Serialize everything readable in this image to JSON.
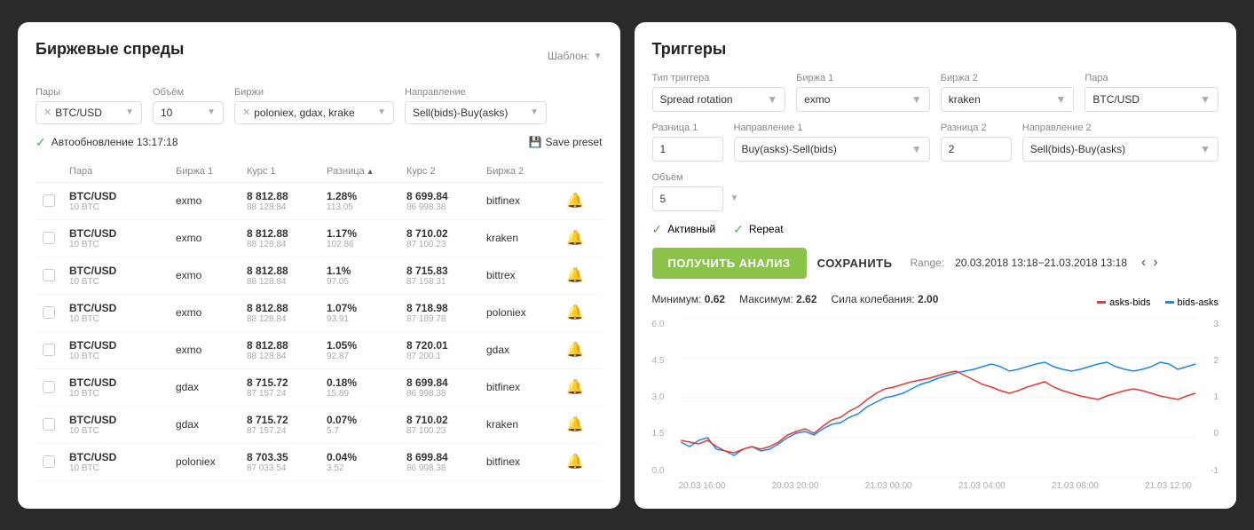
{
  "left_panel": {
    "title": "Биржевые спреды",
    "template_label": "Шаблон:",
    "filters": {
      "pairs_label": "Пары",
      "pairs_value": "BTC/USD",
      "volume_label": "Объём",
      "volume_value": "10",
      "exchanges_label": "Биржи",
      "exchanges_value": "poloniex, gdax, krake",
      "direction_label": "Направление",
      "direction_value": "Sell(bids)-Buy(asks)"
    },
    "autoupdate": "Автообновление 13:17:18",
    "save_preset": "Save preset",
    "table": {
      "columns": [
        "",
        "Пара",
        "Биржа 1",
        "Курс 1",
        "Разница",
        "Курс 2",
        "Биржа 2",
        ""
      ],
      "rows": [
        {
          "pair": "BTC/USD",
          "volume": "10 BTC",
          "exchange1": "exmo",
          "price1": "8 812.88",
          "price1_sub": "88 128.84",
          "diff_pct": "1.28%",
          "diff_abs": "113.05",
          "price2": "8 699.84",
          "price2_sub": "86 998.38",
          "exchange2": "bitfinex"
        },
        {
          "pair": "BTC/USD",
          "volume": "10 BTC",
          "exchange1": "exmo",
          "price1": "8 812.88",
          "price1_sub": "88 128.84",
          "diff_pct": "1.17%",
          "diff_abs": "102.86",
          "price2": "8 710.02",
          "price2_sub": "87 100.23",
          "exchange2": "kraken"
        },
        {
          "pair": "BTC/USD",
          "volume": "10 BTC",
          "exchange1": "exmo",
          "price1": "8 812.88",
          "price1_sub": "88 128.84",
          "diff_pct": "1.1%",
          "diff_abs": "97.05",
          "price2": "8 715.83",
          "price2_sub": "87 158.31",
          "exchange2": "bittrex"
        },
        {
          "pair": "BTC/USD",
          "volume": "10 BTC",
          "exchange1": "exmo",
          "price1": "8 812.88",
          "price1_sub": "88 128.84",
          "diff_pct": "1.07%",
          "diff_abs": "93.91",
          "price2": "8 718.98",
          "price2_sub": "87 189.78",
          "exchange2": "poloniex"
        },
        {
          "pair": "BTC/USD",
          "volume": "10 BTC",
          "exchange1": "exmo",
          "price1": "8 812.88",
          "price1_sub": "88 128.84",
          "diff_pct": "1.05%",
          "diff_abs": "92.87",
          "price2": "8 720.01",
          "price2_sub": "87 200.1",
          "exchange2": "gdax"
        },
        {
          "pair": "BTC/USD",
          "volume": "10 BTC",
          "exchange1": "gdax",
          "price1": "8 715.72",
          "price1_sub": "87 157.24",
          "diff_pct": "0.18%",
          "diff_abs": "15.89",
          "price2": "8 699.84",
          "price2_sub": "86 998.38",
          "exchange2": "bitfinex"
        },
        {
          "pair": "BTC/USD",
          "volume": "10 BTC",
          "exchange1": "gdax",
          "price1": "8 715.72",
          "price1_sub": "87 157.24",
          "diff_pct": "0.07%",
          "diff_abs": "5.7",
          "price2": "8 710.02",
          "price2_sub": "87 100.23",
          "exchange2": "kraken"
        },
        {
          "pair": "BTC/USD",
          "volume": "10 BTC",
          "exchange1": "poloniex",
          "price1": "8 703.35",
          "price1_sub": "87 033.54",
          "diff_pct": "0.04%",
          "diff_abs": "3.52",
          "price2": "8 699.84",
          "price2_sub": "86 998.38",
          "exchange2": "bitfinex"
        }
      ]
    }
  },
  "right_panel": {
    "title": "Триггеры",
    "trigger_type_label": "Тип триггера",
    "trigger_type_value": "Spread rotation",
    "exchange1_label": "Биржа 1",
    "exchange1_value": "exmo",
    "exchange2_label": "Биржа 2",
    "exchange2_value": "kraken",
    "pair_label": "Пара",
    "pair_value": "BTC/USD",
    "diff1_label": "Разница 1",
    "diff1_value": "1",
    "direction1_label": "Направление 1",
    "direction1_value": "Buy(asks)-Sell(bids)",
    "diff2_label": "Разница 2",
    "diff2_value": "2",
    "direction2_label": "Направление 2",
    "direction2_value": "Sell(bids)-Buy(asks)",
    "volume_label": "Объём",
    "volume_value": "5",
    "active_label": "Активный",
    "repeat_label": "Repeat",
    "get_analysis_btn": "ПОЛУЧИТЬ АНАЛИЗ",
    "save_btn": "СОХРАНИТЬ",
    "range_label": "Range:",
    "range_value": "20.03.2018 13:18−21.03.2018 13:18",
    "chart": {
      "min_label": "Минимум:",
      "min_value": "0.62",
      "max_label": "Максимум:",
      "max_value": "2.62",
      "strength_label": "Сила колебания:",
      "strength_value": "2.00",
      "legend_asks_bids": "asks-bids",
      "legend_bids_asks": "bids-asks",
      "y_labels_left": [
        "6.0",
        "4.5",
        "3.0",
        "1.5",
        "0.0"
      ],
      "y_labels_right": [
        "3",
        "2",
        "1",
        "0",
        "-1"
      ],
      "x_labels": [
        "20.03 16:00",
        "20.03 20:00",
        "21.03 00:00",
        "21.03 04:00",
        "21.03 08:00",
        "21.03 12:00"
      ]
    }
  }
}
